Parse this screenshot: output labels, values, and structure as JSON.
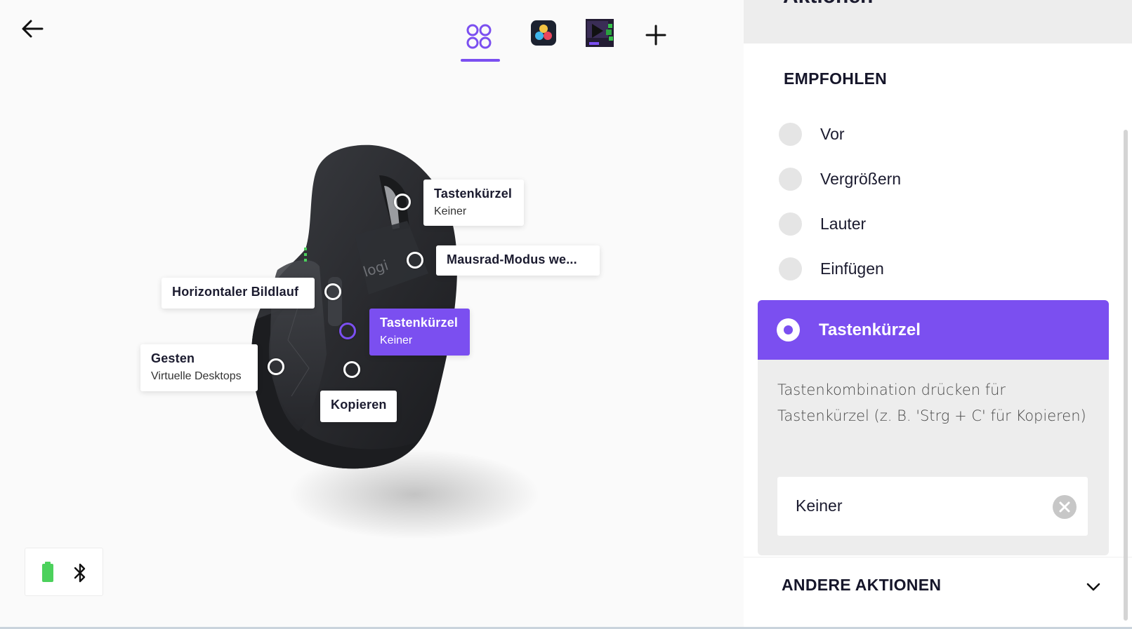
{
  "top_nav": {
    "tabs": [
      {
        "name": "all-apps",
        "active": true
      },
      {
        "name": "davinci-resolve",
        "active": false
      },
      {
        "name": "video-app",
        "active": false
      },
      {
        "name": "add-app",
        "active": false
      }
    ]
  },
  "callouts": {
    "thumb_wheel_top": {
      "title": "Tastenkürzel",
      "subtitle": "Keiner"
    },
    "mode_shift": {
      "title": "Mausrad-Modus we..."
    },
    "horizontal_scroll": {
      "title": "Horizontaler Bildlauf"
    },
    "thumb_button_active": {
      "title": "Tastenkürzel",
      "subtitle": "Keiner"
    },
    "gestures": {
      "title": "Gesten",
      "subtitle": "Virtuelle Desktops"
    },
    "copy": {
      "title": "Kopieren"
    }
  },
  "colors": {
    "accent": "#7b4ff0",
    "battery": "#4cd15c"
  },
  "panel": {
    "title": "Aktionen",
    "recommended_label": "EMPFOHLEN",
    "options": [
      "Vor",
      "Vergrößern",
      "Lauter",
      "Einfügen"
    ],
    "selected": {
      "label": "Tastenkürzel",
      "hint": "Tastenkombination drücken für Tastenkürzel (z. B. 'Strg + C' für Kopieren)",
      "shortcut_value": "Keiner"
    },
    "other_actions_label": "ANDERE AKTIONEN"
  },
  "status": {
    "battery_icon": "battery-full-icon",
    "connection_icon": "bluetooth-icon"
  }
}
